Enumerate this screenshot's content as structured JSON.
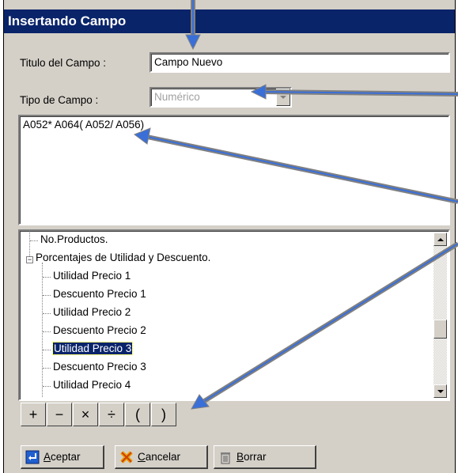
{
  "window": {
    "title": "Insertando Campo"
  },
  "form": {
    "title_label": "Titulo del Campo :",
    "title_value": "Campo Nuevo",
    "type_label": "Tipo de Campo :",
    "type_value": "Numérico",
    "formula": "A052* A064( A052/ A056)"
  },
  "tree": {
    "items": [
      {
        "label": "No.Productos.",
        "level": 1
      },
      {
        "label": "Porcentajes de Utilidad y Descuento.",
        "level": 0,
        "expander": "⊟"
      },
      {
        "label": "Utilidad  Precio 1",
        "level": 1
      },
      {
        "label": "Descuento Precio 1",
        "level": 1
      },
      {
        "label": "Utilidad  Precio 2",
        "level": 1
      },
      {
        "label": "Descuento Precio 2",
        "level": 1
      },
      {
        "label": "Utilidad  Precio 3",
        "level": 1,
        "selected": true
      },
      {
        "label": "Descuento Precio 3",
        "level": 1
      },
      {
        "label": "Utilidad  Precio 4",
        "level": 1
      }
    ]
  },
  "operators": [
    "+",
    "−",
    "×",
    "÷",
    "(",
    ")"
  ],
  "buttons": {
    "accept": {
      "prefix": "",
      "underline": "A",
      "rest": "ceptar"
    },
    "cancel": {
      "prefix": "",
      "underline": "C",
      "rest": "ancelar"
    },
    "delete": {
      "prefix": "",
      "underline": "B",
      "rest": "orrar"
    }
  },
  "colors": {
    "titlebar": "#0a246a",
    "selection": "#0a246a",
    "arrow": "#3a6fd8"
  }
}
